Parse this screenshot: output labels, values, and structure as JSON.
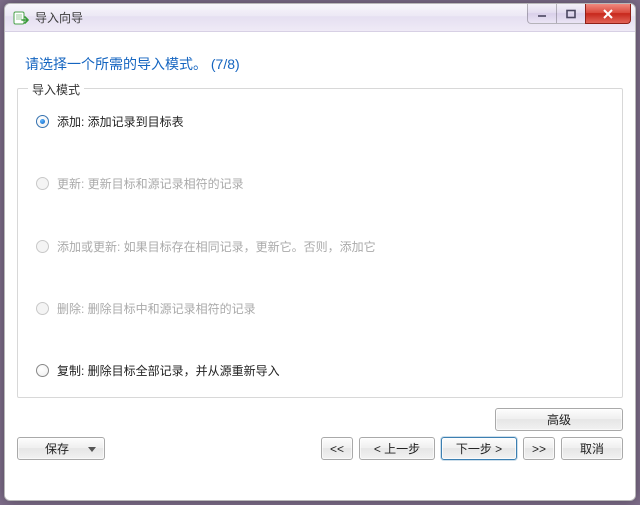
{
  "window": {
    "title": "导入向导"
  },
  "page": {
    "title": "请选择一个所需的导入模式。 (7/8)"
  },
  "group": {
    "legend": "导入模式",
    "options": [
      {
        "label": "添加: 添加记录到目标表",
        "selected": true,
        "enabled": true
      },
      {
        "label": "更新: 更新目标和源记录相符的记录",
        "selected": false,
        "enabled": false
      },
      {
        "label": "添加或更新: 如果目标存在相同记录，更新它。否则，添加它",
        "selected": false,
        "enabled": false
      },
      {
        "label": "删除: 删除目标中和源记录相符的记录",
        "selected": false,
        "enabled": false
      },
      {
        "label": "复制: 删除目标全部记录，并从源重新导入",
        "selected": false,
        "enabled": true
      }
    ]
  },
  "buttons": {
    "advanced": "高级",
    "save": "保存",
    "first": "<<",
    "prev": "< 上一步",
    "next": "下一步 >",
    "last": ">>",
    "cancel": "取消"
  }
}
